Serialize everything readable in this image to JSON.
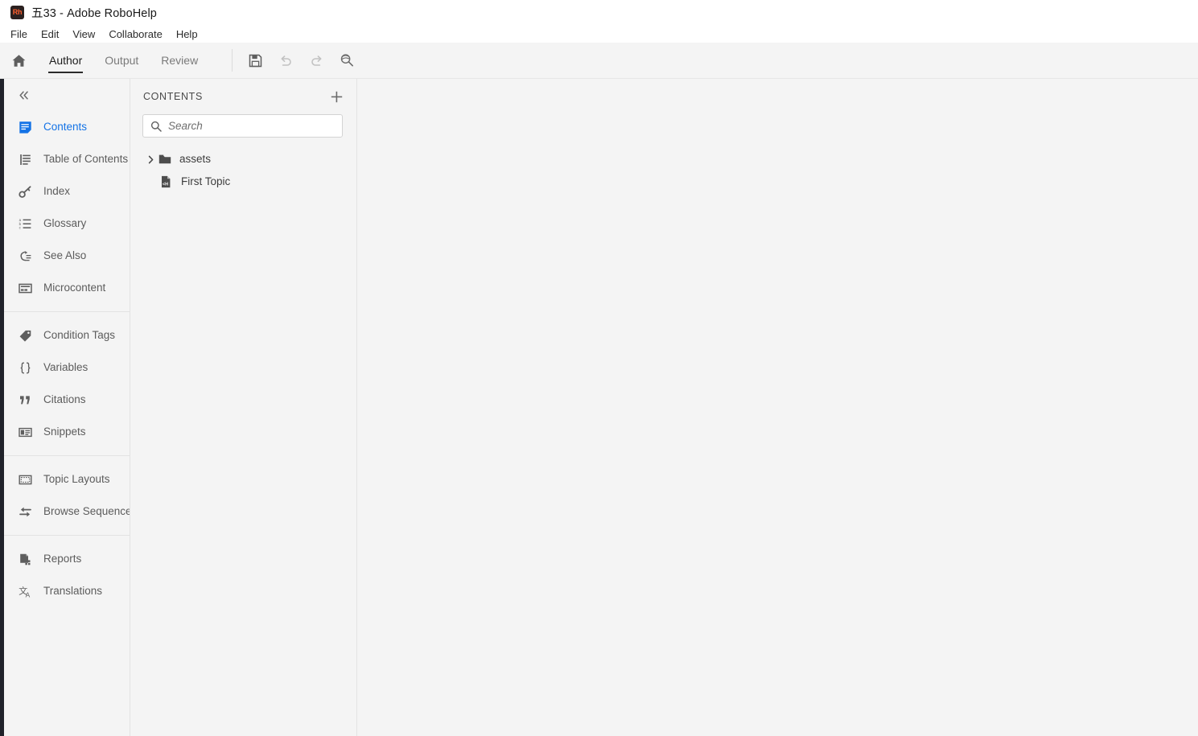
{
  "window": {
    "app_icon_text": "Rh",
    "title": "五33 - Adobe RoboHelp"
  },
  "menubar": {
    "items": [
      {
        "label": "File"
      },
      {
        "label": "Edit"
      },
      {
        "label": "View"
      },
      {
        "label": "Collaborate"
      },
      {
        "label": "Help"
      }
    ]
  },
  "ribbon": {
    "home_icon": "home-icon",
    "tabs": [
      {
        "label": "Author",
        "active": true
      },
      {
        "label": "Output",
        "active": false
      },
      {
        "label": "Review",
        "active": false
      }
    ],
    "tools": [
      {
        "name": "save-icon",
        "label": "Save",
        "enabled": true
      },
      {
        "name": "undo-icon",
        "label": "Undo",
        "enabled": false
      },
      {
        "name": "redo-icon",
        "label": "Redo",
        "enabled": false
      },
      {
        "name": "preview-icon",
        "label": "Preview",
        "enabled": true
      }
    ]
  },
  "sidebar": {
    "collapse_icon": "double-chevron-left-icon",
    "groups": [
      {
        "items": [
          {
            "label": "Contents",
            "icon": "contents-icon",
            "active": true
          },
          {
            "label": "Table of Contents",
            "icon": "table-of-contents-icon",
            "active": false
          },
          {
            "label": "Index",
            "icon": "key-icon",
            "active": false
          },
          {
            "label": "Glossary",
            "icon": "abc-list-icon",
            "active": false
          },
          {
            "label": "See Also",
            "icon": "see-also-icon",
            "active": false
          },
          {
            "label": "Microcontent",
            "icon": "microcontent-icon",
            "active": false
          }
        ]
      },
      {
        "items": [
          {
            "label": "Condition Tags",
            "icon": "tag-icon",
            "active": false
          },
          {
            "label": "Variables",
            "icon": "braces-icon",
            "active": false
          },
          {
            "label": "Citations",
            "icon": "quote-icon",
            "active": false
          },
          {
            "label": "Snippets",
            "icon": "snippet-icon",
            "active": false
          }
        ]
      },
      {
        "items": [
          {
            "label": "Topic Layouts",
            "icon": "topic-layout-icon",
            "active": false
          },
          {
            "label": "Browse Sequences",
            "icon": "browse-sequence-icon",
            "active": false
          }
        ]
      },
      {
        "items": [
          {
            "label": "Reports",
            "icon": "reports-icon",
            "active": false
          },
          {
            "label": "Translations",
            "icon": "translations-icon",
            "active": false
          }
        ]
      }
    ]
  },
  "contents_panel": {
    "title": "CONTENTS",
    "add_icon": "plus-icon",
    "search": {
      "icon": "search-icon",
      "value": "",
      "placeholder": "Search"
    },
    "tree": [
      {
        "label": "assets",
        "type": "folder",
        "icon": "folder-icon",
        "expanded": false,
        "twisty": "chevron-right-icon",
        "indent": 0
      },
      {
        "label": "First Topic",
        "type": "file",
        "icon": "html-file-icon",
        "indent": 1
      }
    ]
  },
  "colors": {
    "accent_blue": "#1473e6",
    "app_icon_orange": "#ff5f2e",
    "chrome_bg": "#f4f4f4",
    "panel_border": "#e3e3e3",
    "text_primary": "#2b2b2b",
    "text_muted": "#7a7a7a"
  }
}
